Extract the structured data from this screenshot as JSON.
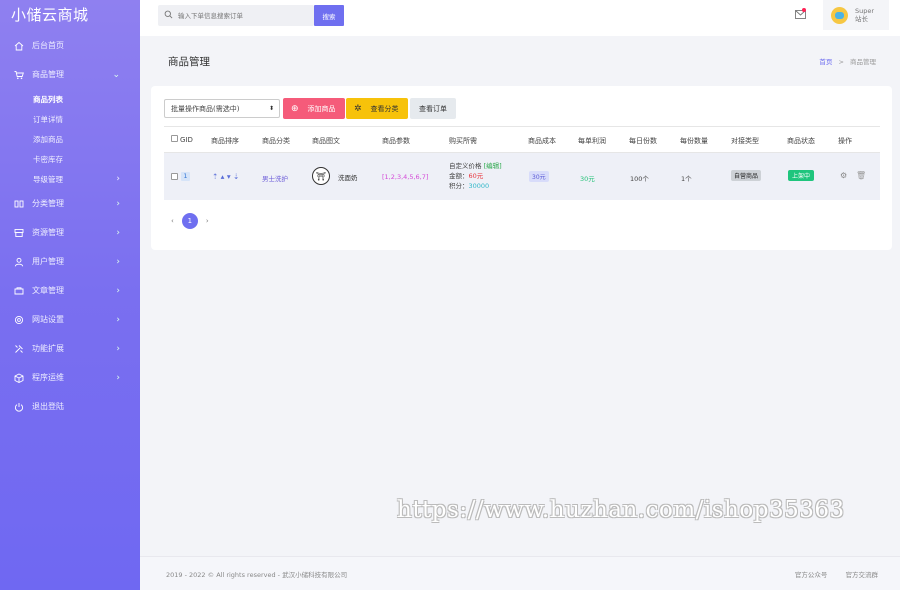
{
  "app": {
    "brand": "小储云商城"
  },
  "sidebar": {
    "items": [
      {
        "label": "后台首页",
        "icon": "home-icon"
      },
      {
        "label": "商品管理",
        "icon": "cart-icon",
        "expanded": true
      },
      {
        "label": "分类管理",
        "icon": "columns-icon"
      },
      {
        "label": "资源管理",
        "icon": "archive-icon"
      },
      {
        "label": "用户管理",
        "icon": "user-icon"
      },
      {
        "label": "文章管理",
        "icon": "doc-icon"
      },
      {
        "label": "网站设置",
        "icon": "settings-icon"
      },
      {
        "label": "功能扩展",
        "icon": "tools-icon"
      },
      {
        "label": "程序运维",
        "icon": "box-icon"
      },
      {
        "label": "退出登陆",
        "icon": "power-icon"
      }
    ],
    "submenu": [
      "商品列表",
      "订单详情",
      "添加商品",
      "卡密库存",
      "导级管理"
    ]
  },
  "header": {
    "search_placeholder": "输入下单信息搜索订单",
    "search_button": "搜索",
    "user_name": "Super",
    "user_role": "站长"
  },
  "page": {
    "title": "商品管理",
    "breadcrumb_home": "首页",
    "breadcrumb_sep": ">",
    "breadcrumb_current": "商品管理"
  },
  "toolbar": {
    "batch_select": "批量操作商品(需选中)",
    "add_label": "添加商品",
    "category_label": "查看分类",
    "order_label": "查看订单"
  },
  "table": {
    "headers": [
      "GID",
      "商品排序",
      "商品分类",
      "商品图文",
      "商品参数",
      "购买所需",
      "商品成本",
      "每单利润",
      "每日份数",
      "每份数量",
      "对接类型",
      "商品状态",
      "操作"
    ],
    "rows": [
      {
        "gid": "1",
        "sort": "⇡ ▴ ▾ ⇣",
        "category": "男士洗护",
        "name": "洗面奶",
        "params": "[1,2,3,4,5,6,7]",
        "buy_line1": "自定义价格",
        "buy_edit": "[编辑]",
        "buy_line2_label": "金额：",
        "buy_line2_value": "60元",
        "buy_line3_label": "积分：",
        "buy_line3_value": "30000",
        "cost": "30元",
        "profit": "30元",
        "daily": "100个",
        "per": "1个",
        "dock": "自营商品",
        "status": "上架中"
      }
    ]
  },
  "pagination": {
    "prev": "‹",
    "current": "1",
    "next": "›"
  },
  "watermark": "https://www.huzhan.com/ishop35363",
  "footer": {
    "copyright": "2019 - 2022 © All rights reserved - 武汉小储科技有限公司",
    "links": [
      "官方公众号",
      "官方交流群"
    ]
  }
}
